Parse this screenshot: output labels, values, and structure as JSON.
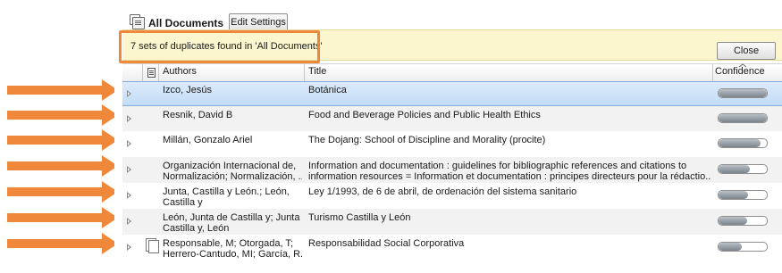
{
  "toolbar": {
    "collection_title": "All Documents",
    "edit_settings_label": "Edit Settings"
  },
  "banner": {
    "message": "7 sets of duplicates found in 'All Documents'",
    "close_label": "Close"
  },
  "table": {
    "columns": {
      "authors": "Authors",
      "title": "Title",
      "confidence": "Confidence"
    },
    "rows": [
      {
        "authors_line1": "Izco, Jesús",
        "authors_line2": "",
        "title_line1": "Botánica",
        "title_line2": "",
        "confidence": 1.0,
        "selected": true,
        "has_attachment": false
      },
      {
        "authors_line1": "Resnik, David B",
        "authors_line2": "",
        "title_line1": "Food and Beverage Policies and Public Health Ethics",
        "title_line2": "",
        "confidence": 1.0,
        "selected": false,
        "has_attachment": false
      },
      {
        "authors_line1": "Millán, Gonzalo Ariel",
        "authors_line2": "",
        "title_line1": "The Dojang: School of Discipline and Morality (procite)",
        "title_line2": "",
        "confidence": 0.87,
        "selected": false,
        "has_attachment": false
      },
      {
        "authors_line1": "Organización Internacional de,",
        "authors_line2": "Normalización; Normalización, ...",
        "title_line1": "Information and documentation : guidelines for bibliographic references and citations to",
        "title_line2": "information resources = Information et documentation : principes directeurs pour la rédactio...",
        "confidence": 0.65,
        "selected": false,
        "has_attachment": false
      },
      {
        "authors_line1": "Junta, Castilla y León.; León,",
        "authors_line2": "Castilla y",
        "title_line1": "Ley 1/1993, de 6 de abril, de ordenación del sistema sanitario",
        "title_line2": "",
        "confidence": 0.62,
        "selected": false,
        "has_attachment": false
      },
      {
        "authors_line1": "León, Junta de Castilla y; Junta de",
        "authors_line2": "Castilla y, León",
        "title_line1": "Turismo Castilla y León",
        "title_line2": "",
        "confidence": 0.6,
        "selected": false,
        "has_attachment": false
      },
      {
        "authors_line1": "Responsable, M; Otorgada, T;",
        "authors_line2": "Herrero-Cantudo, MI; García, R...",
        "title_line1": "Responsabilidad Social Corporativa",
        "title_line2": "",
        "confidence": 0.48,
        "selected": false,
        "has_attachment": true
      }
    ]
  },
  "colors": {
    "annotation_orange": "#f0883b",
    "banner_yellow": "#fcf6cf",
    "selection_blue": "#c3dcf6"
  }
}
